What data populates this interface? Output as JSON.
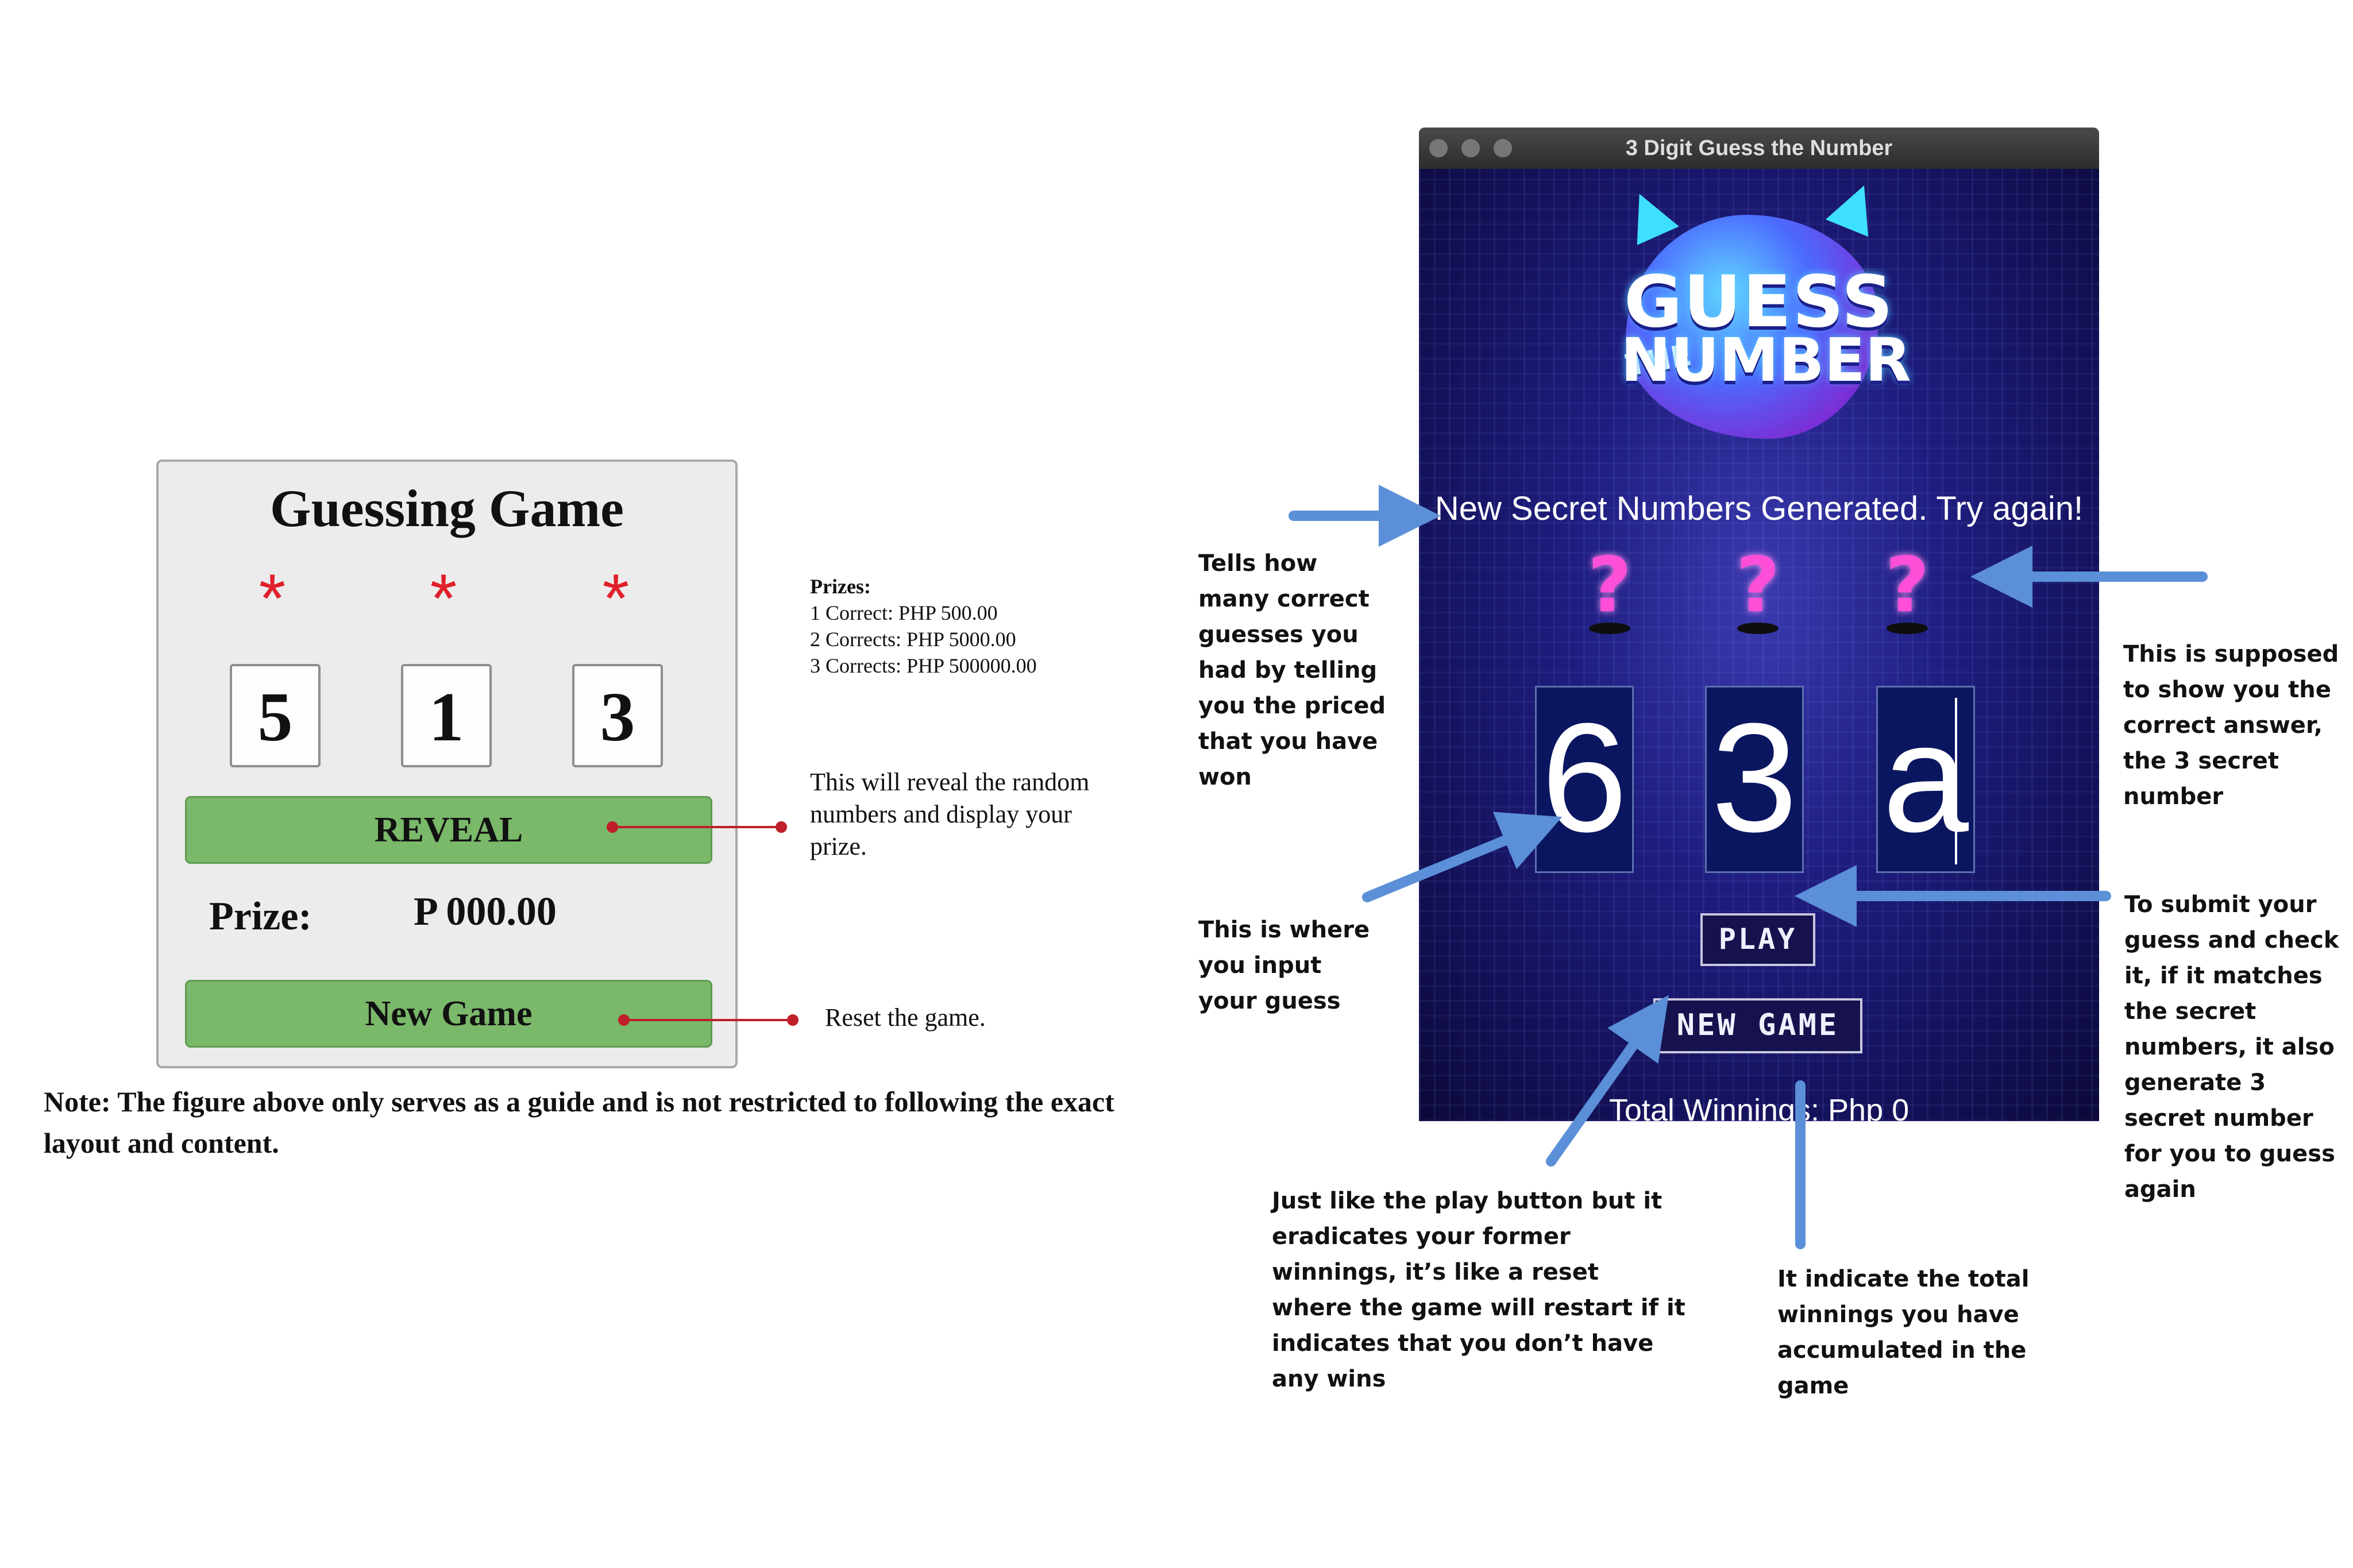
{
  "left_mockup": {
    "title": "Guessing Game",
    "hidden_symbols": [
      "*",
      "*",
      "*"
    ],
    "digits": [
      "5",
      "1",
      "3"
    ],
    "reveal_label": "REVEAL",
    "prize_label": "Prize:",
    "prize_value": "P 000.00",
    "new_game_label": "New Game",
    "prizes_heading": "Prizes:",
    "prizes": [
      "1 Correct: PHP 500.00",
      "2 Corrects: PHP 5000.00",
      "3 Corrects: PHP 500000.00"
    ],
    "reveal_annotation": "This will reveal the random numbers and display your prize.",
    "reset_annotation": "Reset the game.",
    "note": "Note: The figure above only serves as a guide and is not restricted to following the exact layout and content.",
    "accent_green": "#7ab86a",
    "asterisk_red": "#e0202a"
  },
  "game_window": {
    "title": "3 Digit Guess the Number",
    "logo": {
      "guess": "GUESS",
      "the": "THE",
      "number": "NUMBER"
    },
    "status_message": "New Secret Numbers Generated. Try again!",
    "secret_markers": [
      "?",
      "?",
      "?"
    ],
    "guess_inputs": [
      "6",
      "3",
      "a"
    ],
    "play_label": "PLAY",
    "new_game_label": "NEW GAME",
    "total_winnings": "Total Winnings: Php 0",
    "background_color": "#1e1d7e",
    "question_mark_color": "#ff4fd8"
  },
  "annotations": {
    "tells": "Tells how many correct guesses you had by telling you the priced that you have won",
    "input": "This is where you input your guess",
    "supposed": "This is supposed to show you the correct answer, the 3 secret number",
    "submit": "To submit your guess and check it, if it matches the secret numbers, it also generate 3 secret number for you to guess again",
    "just_like": "Just like the play button but it eradicates your former winnings, it’s like a reset where the game will restart if it indicates that you don’t have any wins",
    "indicate": "It indicate the total winnings you have accumulated in the game",
    "arrow_color": "#5b8fd8",
    "connector_color": "#c0202a"
  }
}
